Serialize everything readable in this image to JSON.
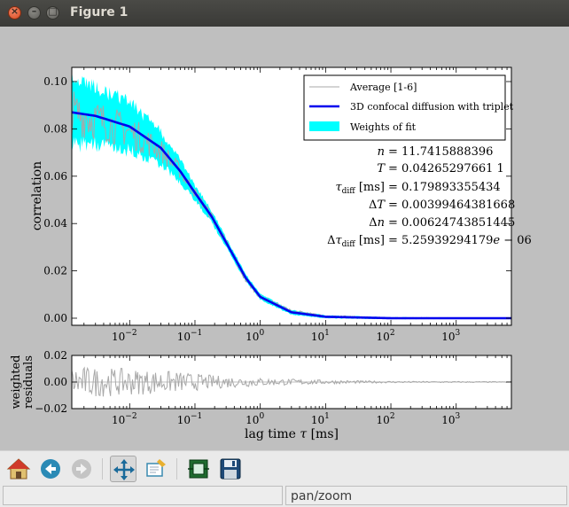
{
  "window": {
    "title": "Figure 1"
  },
  "colors": {
    "data": "#a8a8a8",
    "fit": "#0000ee",
    "weights": "#00ffff",
    "residual": "#a8a8a8"
  },
  "legend": {
    "items": [
      {
        "label": "Average [1-6]",
        "kind": "line-gray"
      },
      {
        "label": "3D confocal diffusion with triplet",
        "kind": "line-blue"
      },
      {
        "label": "Weights of fit",
        "kind": "patch-cyan"
      }
    ]
  },
  "fit_params": [
    {
      "name": "n",
      "value": "= 11.7415888396"
    },
    {
      "name": "T",
      "value": "= 0.04265297661 1"
    },
    {
      "name": "τ_diff [ms]",
      "value": "= 0.179893355434"
    },
    {
      "name": "ΔT",
      "value": "= 0.00399464381668"
    },
    {
      "name": "Δn",
      "value": "= 0.00624743851445"
    },
    {
      "name": "Δτ_diff [ms]",
      "value": "= 5.25939294179e − 06"
    }
  ],
  "chart_data": [
    {
      "type": "line",
      "ylabel": "correlation",
      "xscale": "log",
      "xlim": [
        0.0013,
        7000
      ],
      "ylim": [
        -0.003,
        0.106
      ],
      "yticks": [
        "0.00",
        "0.02",
        "0.04",
        "0.06",
        "0.08",
        "0.10"
      ],
      "xticks": [
        "10^-2",
        "10^-1",
        "10^0",
        "10^1",
        "10^2",
        "10^3"
      ],
      "legend_position": "top-right",
      "series": [
        {
          "name": "Average [1-6]",
          "role": "data",
          "x": [
            0.0013,
            0.003,
            0.01,
            0.03,
            0.06,
            0.1,
            0.18,
            0.3,
            0.6,
            1,
            3,
            10,
            100,
            1000,
            7000
          ],
          "y": [
            0.087,
            0.084,
            0.079,
            0.071,
            0.062,
            0.053,
            0.043,
            0.032,
            0.016,
            0.009,
            0.003,
            0.0008,
            0.0001,
            0.0,
            0.0
          ]
        },
        {
          "name": "3D confocal diffusion with triplet",
          "role": "fit",
          "x": [
            0.0013,
            0.003,
            0.01,
            0.03,
            0.06,
            0.1,
            0.18,
            0.3,
            0.6,
            1,
            3,
            10,
            100,
            1000,
            7000
          ],
          "y": [
            0.087,
            0.0855,
            0.081,
            0.072,
            0.062,
            0.053,
            0.043,
            0.032,
            0.017,
            0.009,
            0.0025,
            0.0006,
            0.0,
            0.0,
            0.0
          ]
        },
        {
          "name": "Weights of fit",
          "role": "band",
          "x": [
            0.0013,
            0.003,
            0.01,
            0.03,
            0.06,
            0.1,
            0.3,
            1,
            10,
            100,
            7000
          ],
          "half_width": [
            0.018,
            0.016,
            0.013,
            0.009,
            0.006,
            0.004,
            0.0025,
            0.0015,
            0.0008,
            0.0005,
            0.0003
          ]
        }
      ]
    },
    {
      "type": "line",
      "ylabel": "weighted residuals",
      "xlabel": "lag time τ [ms]",
      "xscale": "log",
      "xlim": [
        0.0013,
        7000
      ],
      "ylim": [
        -0.02,
        0.02
      ],
      "yticks": [
        "−0.02",
        "0.00",
        "0.02"
      ],
      "xticks": [
        "10^-2",
        "10^-1",
        "10^0",
        "10^1",
        "10^2",
        "10^3"
      ],
      "series": [
        {
          "name": "residuals",
          "envelope": [
            {
              "x": 0.0013,
              "amp": 0.012
            },
            {
              "x": 0.01,
              "amp": 0.01
            },
            {
              "x": 0.05,
              "amp": 0.008
            },
            {
              "x": 0.2,
              "amp": 0.005
            },
            {
              "x": 1,
              "amp": 0.003
            },
            {
              "x": 10,
              "amp": 0.0015
            },
            {
              "x": 100,
              "amp": 0.0006
            },
            {
              "x": 7000,
              "amp": 0.0003
            }
          ]
        }
      ]
    }
  ],
  "toolbar": {
    "buttons": [
      {
        "name": "home",
        "tooltip": "Reset original view"
      },
      {
        "name": "back",
        "tooltip": "Back to previous view"
      },
      {
        "name": "forward",
        "tooltip": "Forward to next view"
      },
      {
        "name": "pan",
        "tooltip": "Pan axes"
      },
      {
        "name": "zoom",
        "tooltip": "Zoom to rectangle"
      },
      {
        "name": "subplots",
        "tooltip": "Configure subplots"
      },
      {
        "name": "save",
        "tooltip": "Save the figure"
      }
    ]
  },
  "status": {
    "left": "",
    "right": "pan/zoom"
  }
}
